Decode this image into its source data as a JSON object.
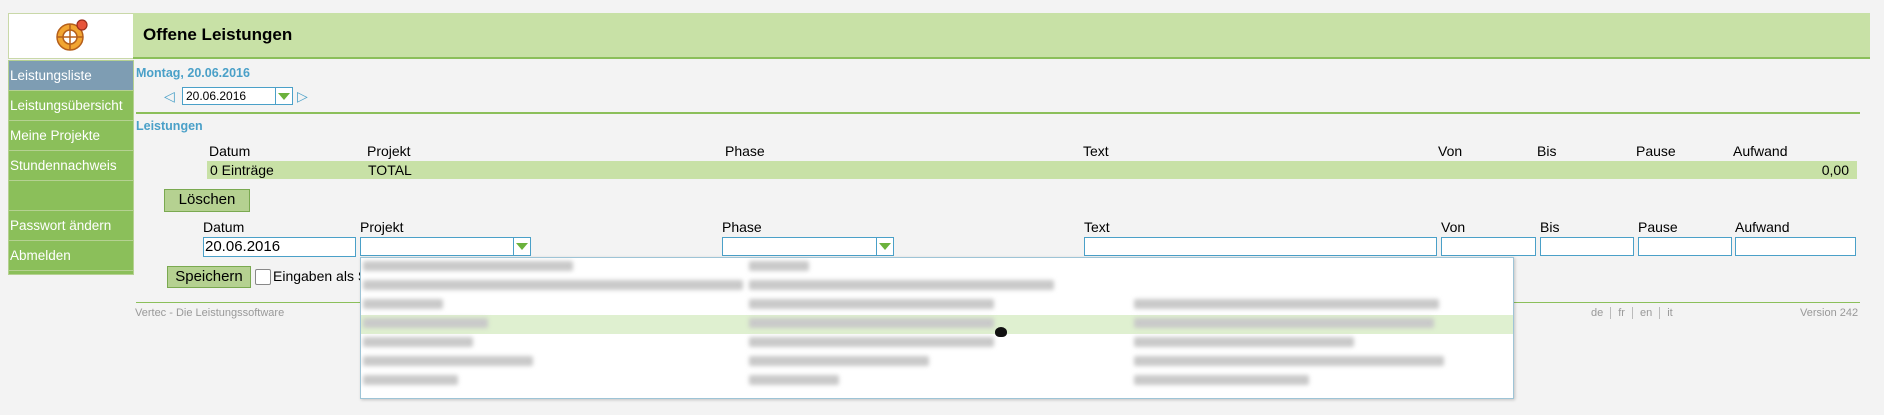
{
  "header": {
    "title": "Offene Leistungen"
  },
  "sidebar": {
    "items": [
      {
        "label": "Leistungsliste"
      },
      {
        "label": "Leistungsübersicht"
      },
      {
        "label": "Meine Projekte"
      },
      {
        "label": "Stundennachweis"
      },
      {
        "label": ""
      },
      {
        "label": "Passwort ändern"
      },
      {
        "label": "Abmelden"
      }
    ]
  },
  "date_header": "Montag, 20.06.2016",
  "date_picker": {
    "value": "20.06.2016"
  },
  "section_title": "Leistungen",
  "table": {
    "headers": [
      "Datum",
      "Projekt",
      "Phase",
      "Text",
      "Von",
      "Bis",
      "Pause",
      "Aufwand"
    ],
    "total_row": {
      "count": "0 Einträge",
      "project": "TOTAL",
      "sum": "0,00"
    }
  },
  "buttons": {
    "delete": "Löschen",
    "save": "Speichern"
  },
  "form": {
    "headers": [
      "Datum",
      "Projekt",
      "Phase",
      "Text",
      "Von",
      "Bis",
      "Pause",
      "Aufwand"
    ],
    "date_value": "20.06.2016",
    "checkbox_label": "Eingaben als S"
  },
  "footer": {
    "left": "Vertec - Die Leistungssoftware",
    "languages": [
      "de",
      "fr",
      "en",
      "it"
    ],
    "version": "Version 242"
  },
  "colors": {
    "accent_green": "#8bbf5a",
    "header_green": "#c8e1a6",
    "link_blue": "#4aa0c8",
    "active_item": "#7e9db3"
  }
}
